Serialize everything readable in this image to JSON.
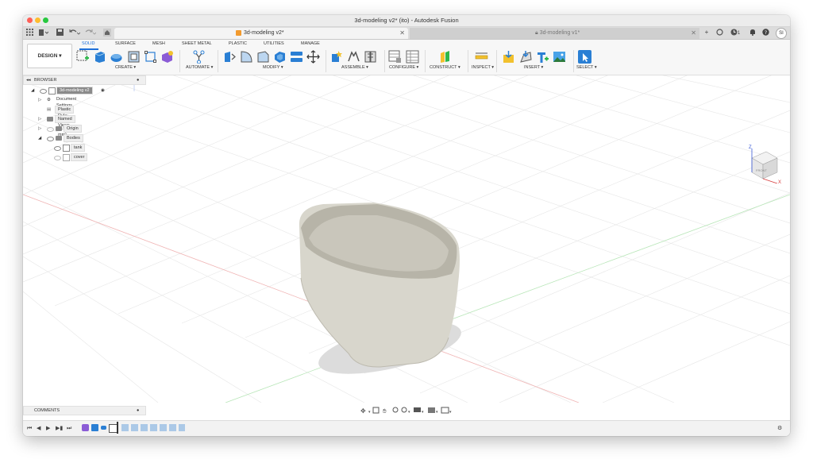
{
  "window": {
    "title": "3d-modeling v2* (ito) - Autodesk Fusion"
  },
  "tabs": [
    {
      "label": "3d-modeling v2*",
      "active": true
    },
    {
      "label": "3d-modeling v1*",
      "active": false
    }
  ],
  "header": {
    "notifications_count": "1",
    "avatar_initials": "SI"
  },
  "workspace": {
    "label": "DESIGN"
  },
  "toolbar_tabs": [
    "SOLID",
    "SURFACE",
    "MESH",
    "SHEET METAL",
    "PLASTIC",
    "UTILITIES",
    "MANAGE"
  ],
  "tool_groups": [
    "CREATE",
    "AUTOMATE",
    "MODIFY",
    "ASSEMBLE",
    "CONFIGURE",
    "CONSTRUCT",
    "INSPECT",
    "INSERT",
    "SELECT"
  ],
  "browser": {
    "title": "BROWSER",
    "root": "3d-modeling v2",
    "items": [
      "Document Settings",
      "Plastic Rule: ABS (1.5 mm)",
      "Named Views",
      "Origin",
      "Bodies"
    ],
    "bodies": [
      "tank",
      "cover"
    ]
  },
  "comments": {
    "title": "COMMENTS"
  },
  "viewcube": {
    "z": "Z",
    "x": "X",
    "face": "FRONT"
  },
  "colors": {
    "accent": "#1e6fd9",
    "model": "#d8d6cc",
    "close": "#ff5f57",
    "min": "#febc2e",
    "max": "#28c840"
  },
  "icons": [
    "grid-icon",
    "file-icon",
    "save-icon",
    "undo-icon",
    "redo-icon",
    "home-icon",
    "plus-icon",
    "job-status-icon",
    "clock-icon",
    "bell-icon",
    "help-icon",
    "settings-icon"
  ]
}
